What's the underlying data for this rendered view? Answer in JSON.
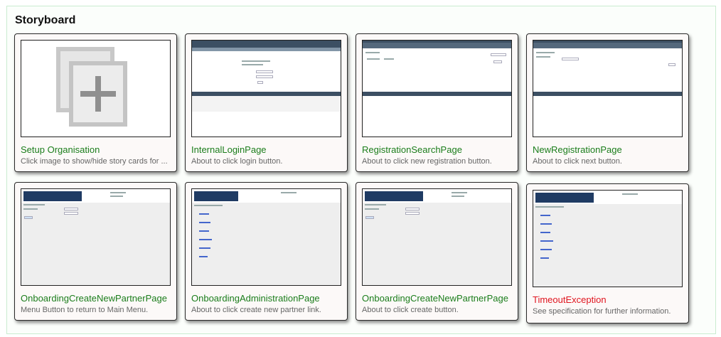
{
  "board": {
    "title": "Storyboard"
  },
  "cards": [
    {
      "title": "Setup Organisation",
      "desc": "Click image to show/hide story cards for ...",
      "thumb_icon": "add-page-icon"
    },
    {
      "title": "InternalLoginPage",
      "desc": "About to click login button.",
      "thumb_icon": "login-page-thumbnail"
    },
    {
      "title": "RegistrationSearchPage",
      "desc": "About to click new registration button.",
      "thumb_icon": "search-page-thumbnail"
    },
    {
      "title": "NewRegistrationPage",
      "desc": "About to click next button.",
      "thumb_icon": "registration-page-thumbnail"
    },
    {
      "title": "OnboardingCreateNewPartnerPage",
      "desc": "Menu Button to return to Main Menu.",
      "thumb_icon": "partner-page-thumbnail"
    },
    {
      "title": "OnboardingAdministrationPage",
      "desc": "About to click create new partner link.",
      "thumb_icon": "admin-page-thumbnail"
    },
    {
      "title": "OnboardingCreateNewPartnerPage",
      "desc": "About to click create button.",
      "thumb_icon": "partner-page-thumbnail"
    },
    {
      "title": "TimeoutException",
      "desc": "See specification for further information.",
      "thumb_icon": "timeout-page-thumbnail",
      "status": "error"
    }
  ],
  "colors": {
    "title_ok": "#1b7d1b",
    "title_error": "#e0141e",
    "board_border": "#c9ecd0"
  }
}
